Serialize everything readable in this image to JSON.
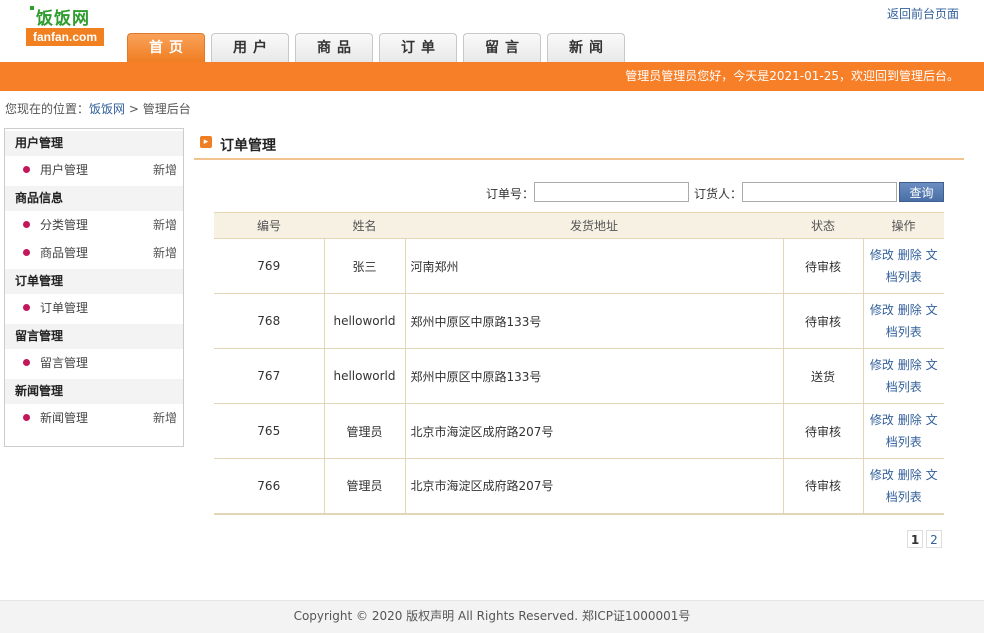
{
  "logo": {
    "cn": "饭饭网",
    "en": "fanfan.com"
  },
  "back_link": "返回前台页面",
  "nav": [
    "首页",
    "用户",
    "商品",
    "订单",
    "留言",
    "新闻"
  ],
  "welcome": "管理员管理员您好，今天是2021-01-25，欢迎回到管理后台。",
  "breadcrumb": {
    "prefix": "您现在的位置：",
    "home": "饭饭网",
    "sep": ">",
    "current": "管理后台"
  },
  "sidebar": {
    "g1": "用户管理",
    "g1i1": "用户管理",
    "g1i1add": "新增",
    "g2": "商品信息",
    "g2i1": "分类管理",
    "g2i1add": "新增",
    "g2i2": "商品管理",
    "g2i2add": "新增",
    "g3": "订单管理",
    "g3i1": "订单管理",
    "g4": "留言管理",
    "g4i1": "留言管理",
    "g5": "新闻管理",
    "g5i1": "新闻管理",
    "g5i1add": "新增"
  },
  "main": {
    "title": "订单管理",
    "search": {
      "order_label": "订单号：",
      "orderer_label": "订货人：",
      "button": "查询"
    },
    "columns": [
      "编号",
      "姓名",
      "发货地址",
      "状态",
      "操作"
    ],
    "rows": [
      {
        "id": "769",
        "name": "张三",
        "address": "河南郑州",
        "status": "待审核"
      },
      {
        "id": "768",
        "name": "helloworld",
        "address": "郑州中原区中原路133号",
        "status": "待审核"
      },
      {
        "id": "767",
        "name": "helloworld",
        "address": "郑州中原区中原路133号",
        "status": "送货"
      },
      {
        "id": "765",
        "name": "管理员",
        "address": "北京市海淀区成府路207号",
        "status": "待审核"
      },
      {
        "id": "766",
        "name": "管理员",
        "address": "北京市海淀区成府路207号",
        "status": "待审核"
      }
    ],
    "ops": {
      "edit": "修改",
      "delete": "删除",
      "doc": "文档列表"
    },
    "pager": {
      "current": "1",
      "next": "2"
    }
  },
  "footer": "Copyright © 2020 版权声明 All Rights Reserved. 郑ICP证1000001号",
  "colors": {
    "accent": "#f77f27",
    "link": "#33609b",
    "logo_green": "#2e9c2e"
  }
}
